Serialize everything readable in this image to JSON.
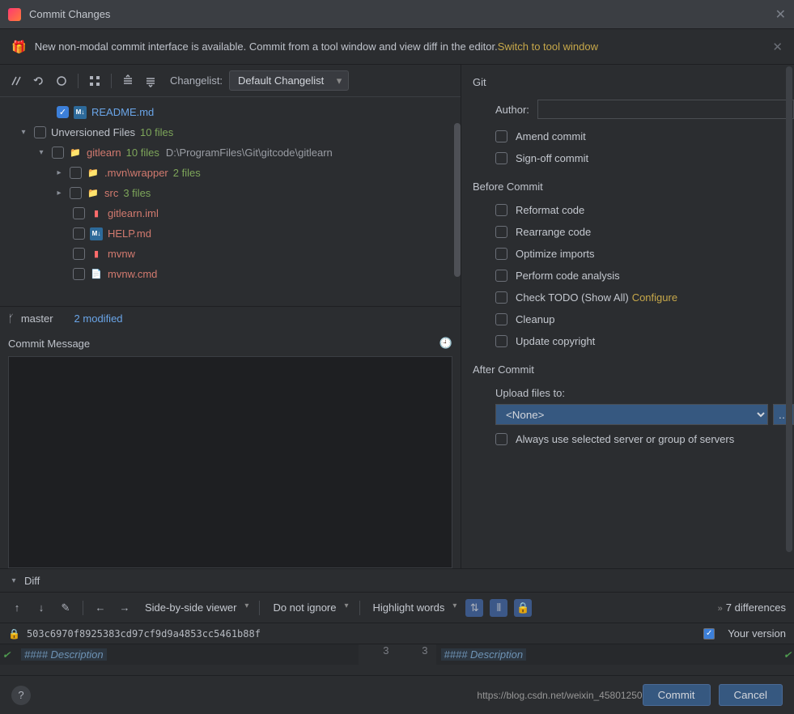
{
  "window": {
    "title": "Commit Changes"
  },
  "banner": {
    "message": "New non-modal commit interface is available. Commit from a tool window and view diff in the editor. ",
    "link": "Switch to tool window"
  },
  "toolbar": {
    "changelist_label": "Changelist:",
    "changelist_value": "Default Changelist"
  },
  "tree": {
    "readme": "README.md",
    "unversioned": "Unversioned Files",
    "unversioned_count": "10 files",
    "gitlearn": "gitlearn",
    "gitlearn_count": "10 files",
    "gitlearn_path": "D:\\ProgramFiles\\Git\\gitcode\\gitlearn",
    "mvn_wrapper": ".mvn\\wrapper",
    "mvn_wrapper_count": "2 files",
    "src": "src",
    "src_count": "3 files",
    "gitlearn_iml": "gitlearn.iml",
    "help_md": "HELP.md",
    "mvnw": "mvnw",
    "mvnw_cmd": "mvnw.cmd"
  },
  "status": {
    "branch": "master",
    "modified": "2 modified"
  },
  "commit_message": {
    "label": "Commit Message"
  },
  "git": {
    "section": "Git",
    "author_label": "Author:",
    "amend": "Amend commit",
    "signoff": "Sign-off commit"
  },
  "before": {
    "section": "Before Commit",
    "reformat": "Reformat code",
    "rearrange": "Rearrange code",
    "optimize": "Optimize imports",
    "analysis": "Perform code analysis",
    "todo": "Check TODO (Show All)",
    "todo_configure": "Configure",
    "cleanup": "Cleanup",
    "copyright": "Update copyright"
  },
  "after": {
    "section": "After Commit",
    "upload_label": "Upload files to:",
    "upload_value": "<None>",
    "always": "Always use selected server or group of servers"
  },
  "diff": {
    "label": "Diff",
    "viewer": "Side-by-side viewer",
    "ignore": "Do not ignore",
    "highlight": "Highlight words",
    "differences": "7 differences",
    "hash": "503c6970f8925383cd97cf9d9a4853cc5461b88f",
    "your_version": "Your version",
    "desc_left": "#### Description",
    "desc_right": "#### Description",
    "line_left": "3",
    "line_right": "3"
  },
  "buttons": {
    "commit": "Commit",
    "cancel": "Cancel"
  },
  "watermark": "https://blog.csdn.net/weixin_45801250"
}
